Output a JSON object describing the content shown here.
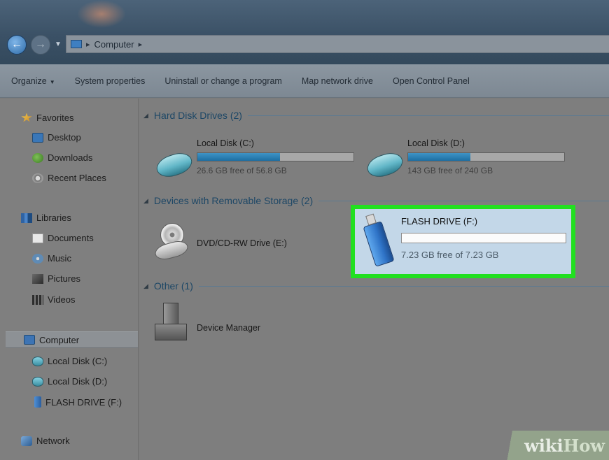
{
  "window": {
    "address": {
      "location": "Computer"
    }
  },
  "toolbar": {
    "items": [
      "Organize",
      "System properties",
      "Uninstall or change a program",
      "Map network drive",
      "Open Control Panel"
    ]
  },
  "sidebar": {
    "favorites": {
      "label": "Favorites",
      "items": [
        "Desktop",
        "Downloads",
        "Recent Places"
      ]
    },
    "libraries": {
      "label": "Libraries",
      "items": [
        "Documents",
        "Music",
        "Pictures",
        "Videos"
      ]
    },
    "computer": {
      "label": "Computer",
      "items": [
        "Local Disk (C:)",
        "Local Disk (D:)",
        "FLASH DRIVE (F:)"
      ]
    },
    "network": {
      "label": "Network"
    }
  },
  "content": {
    "groups": {
      "hdd": "Hard Disk Drives (2)",
      "removable": "Devices with Removable Storage (2)",
      "other": "Other (1)"
    },
    "drives": [
      {
        "name": "Local Disk (C:)",
        "free": "26.6 GB free of 56.8 GB",
        "used_fraction": 0.53
      },
      {
        "name": "Local Disk (D:)",
        "free": "143 GB free of 240 GB",
        "used_fraction": 0.4
      }
    ],
    "dvd": {
      "name": "DVD/CD-RW Drive (E:)"
    },
    "flash": {
      "name": "FLASH DRIVE (F:)",
      "free": "7.23 GB free of 7.23 GB",
      "used_fraction": 0.0
    },
    "other": {
      "name": "Device Manager"
    }
  },
  "colors": {
    "highlight": "#21e020",
    "accent": "#1c6fa3"
  },
  "watermark": {
    "a": "wiki",
    "b": "How"
  }
}
